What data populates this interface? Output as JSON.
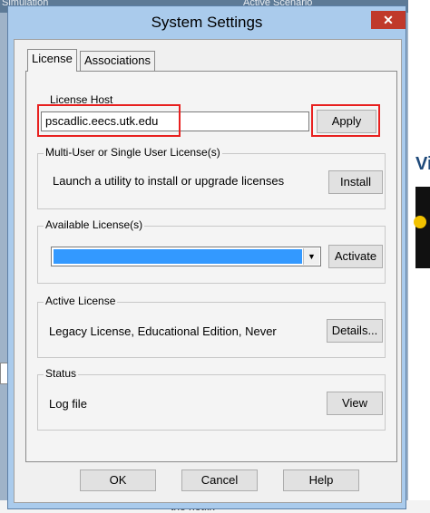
{
  "background": {
    "top_left_text": "Simulation",
    "top_center_text": "Active Scenario",
    "right_partial_text": "Vi",
    "bottom_partial_text": "the hotfix"
  },
  "dialog": {
    "title": "System Settings",
    "close_glyph": "✕",
    "tabs": [
      {
        "label": "License",
        "active": true
      },
      {
        "label": "Associations",
        "active": false
      }
    ],
    "license_host": {
      "group_label": "License Host",
      "value": "pscadlic.eecs.utk.edu",
      "apply_label": "Apply"
    },
    "multi_user": {
      "group_label": "Multi-User or Single User License(s)",
      "description": "Launch a utility to install or upgrade licenses",
      "install_label": "Install"
    },
    "available": {
      "group_label": "Available License(s)",
      "selected_value": "",
      "activate_label": "Activate"
    },
    "active_license": {
      "group_label": "Active License",
      "description": "Legacy License,  Educational Edition,  Never",
      "details_label": "Details..."
    },
    "status": {
      "group_label": "Status",
      "description": "Log file",
      "view_label": "View"
    },
    "buttons": {
      "ok": "OK",
      "cancel": "Cancel",
      "help": "Help"
    },
    "highlight_color": "#e8201f",
    "selection_color": "#3399ff"
  }
}
